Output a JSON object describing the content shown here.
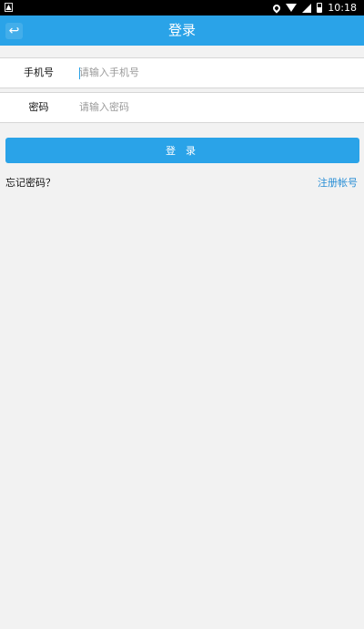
{
  "status_bar": {
    "time": "10:18",
    "icons": [
      "notification-icon",
      "location-icon",
      "wifi-icon",
      "signal-icon",
      "battery-icon"
    ]
  },
  "navbar": {
    "title": "登录",
    "back_icon": "back-arrow-icon"
  },
  "form": {
    "phone_label": "手机号",
    "phone_placeholder": "请输入手机号",
    "phone_value": "",
    "password_label": "密码",
    "password_placeholder": "请输入密码",
    "password_value": ""
  },
  "actions": {
    "login_label": "登 录",
    "forgot_label": "忘记密码？",
    "register_label": "注册帐号"
  },
  "colors": {
    "accent": "#2aa3e8",
    "background": "#f2f2f2",
    "link": "#2a8fd6"
  }
}
